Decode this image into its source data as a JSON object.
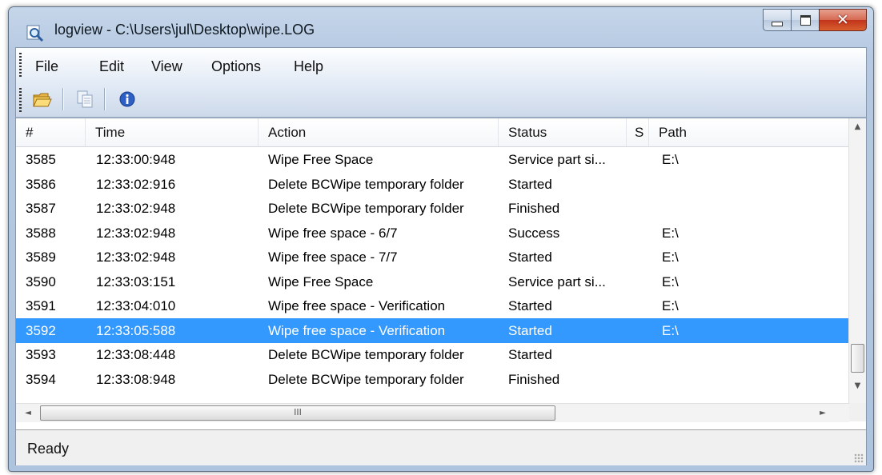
{
  "window": {
    "title": "logview - C:\\Users\\jul\\Desktop\\wipe.LOG",
    "icon": "magnifier-log-icon",
    "controls": {
      "minimize": "minimize-icon",
      "maximize": "maximize-icon",
      "close": "✕"
    }
  },
  "menu": [
    "File",
    "Edit",
    "View",
    "Options",
    "Help"
  ],
  "toolbar": {
    "buttons": [
      {
        "icon": "open-folder-icon"
      },
      {
        "icon": "copy-icon"
      },
      {
        "icon": "info-icon"
      }
    ]
  },
  "table": {
    "columns": [
      "#",
      "Time",
      "Action",
      "Status",
      "S",
      "Path"
    ],
    "selected_index": 7,
    "rows": [
      {
        "num": "3585",
        "time": "12:33:00:948",
        "action": "Wipe Free Space",
        "status": "Service part si...",
        "s": "",
        "path": "E:\\"
      },
      {
        "num": "3586",
        "time": "12:33:02:916",
        "action": "Delete BCWipe temporary folder",
        "status": "Started",
        "s": "",
        "path": ""
      },
      {
        "num": "3587",
        "time": "12:33:02:948",
        "action": "Delete BCWipe temporary folder",
        "status": "Finished",
        "s": "",
        "path": ""
      },
      {
        "num": "3588",
        "time": "12:33:02:948",
        "action": "Wipe free space - 6/7",
        "status": "Success",
        "s": "",
        "path": "E:\\"
      },
      {
        "num": "3589",
        "time": "12:33:02:948",
        "action": "Wipe free space - 7/7",
        "status": "Started",
        "s": "",
        "path": "E:\\"
      },
      {
        "num": "3590",
        "time": "12:33:03:151",
        "action": "Wipe Free Space",
        "status": "Service part si...",
        "s": "",
        "path": "E:\\"
      },
      {
        "num": "3591",
        "time": "12:33:04:010",
        "action": "Wipe free space - Verification",
        "status": "Started",
        "s": "",
        "path": "E:\\"
      },
      {
        "num": "3592",
        "time": "12:33:05:588",
        "action": "Wipe free space - Verification",
        "status": "Started",
        "s": "",
        "path": "E:\\"
      },
      {
        "num": "3593",
        "time": "12:33:08:448",
        "action": "Delete BCWipe temporary folder",
        "status": "Started",
        "s": "",
        "path": ""
      },
      {
        "num": "3594",
        "time": "12:33:08:948",
        "action": "Delete BCWipe temporary folder",
        "status": "Finished",
        "s": "",
        "path": ""
      }
    ]
  },
  "scrollbars": {
    "up": "▲",
    "down": "▼",
    "left": "◄",
    "right": "►",
    "h_thumb_grip": "III"
  },
  "status": {
    "text": "Ready"
  },
  "colors": {
    "selection": "#3399ff",
    "title_gradient": "#b6c9e1"
  }
}
